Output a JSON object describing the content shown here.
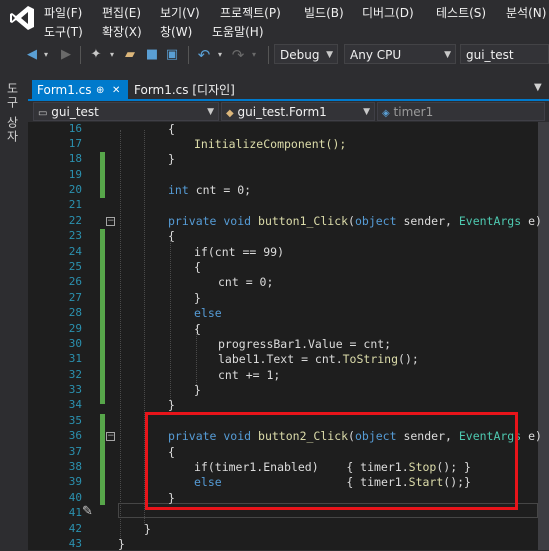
{
  "menu": {
    "row1": [
      "파일(F)",
      "편집(E)",
      "보기(V)",
      "프로젝트(P)",
      "빌드(B)",
      "디버그(D)",
      "테스트(S)",
      "분석(N)"
    ],
    "row2": [
      "도구(T)",
      "확장(X)",
      "창(W)",
      "도움말(H)"
    ]
  },
  "toolbar": {
    "config": "Debug",
    "platform": "Any CPU",
    "startup": "gui_test"
  },
  "toolbox_label": "도구 상자",
  "tabs": {
    "active": "Form1.cs",
    "active_pin": "⊕",
    "active_close": "✕",
    "inactive": "Form1.cs [디자인]"
  },
  "navbar": {
    "project": "gui_test",
    "class": "gui_test.Form1",
    "member": "timer1"
  },
  "code": {
    "line_numbers": [
      16,
      17,
      18,
      19,
      20,
      21,
      22,
      23,
      24,
      25,
      26,
      27,
      28,
      29,
      30,
      31,
      32,
      33,
      34,
      35,
      36,
      37,
      38,
      39,
      40,
      41,
      42,
      43
    ],
    "lines": {
      "l16": "{",
      "l17": "InitializeComponent();",
      "l18": "}",
      "l20_kw": "int",
      "l20": " cnt = 0;",
      "l22_a": "private void",
      "l22_m": "button1_Click",
      "l22_b": "(",
      "l22_c": "object",
      "l22_d": " sender, ",
      "l22_e": "EventArgs",
      "l22_f": " e)",
      "l23": "{",
      "l24": "if(cnt == 99)",
      "l25": "{",
      "l26": "cnt = 0;",
      "l27": "}",
      "l28": "else",
      "l29": "{",
      "l30": "progressBar1.Value = cnt;",
      "l31_a": "label1.Text = cnt.",
      "l31_m": "ToString",
      "l31_b": "();",
      "l32": "cnt += 1;",
      "l33": "}",
      "l34": "}",
      "l36_a": "private void",
      "l36_m": "button2_Click",
      "l36_b": "(",
      "l36_c": "object",
      "l36_d": " sender, ",
      "l36_e": "EventArgs",
      "l36_f": " e)",
      "l37": "{",
      "l38_a": "if(timer1.Enabled)    { timer1.",
      "l38_m": "Stop",
      "l38_b": "(); }",
      "l39_kw": "else",
      "l39_a": "                  { timer1.",
      "l39_m": "Start",
      "l39_b": "();}",
      "l40": "}",
      "l42": "}",
      "l43": "}"
    }
  },
  "colors": {
    "accent": "#007acc",
    "highlight_box": "#e8141a",
    "change_bar": "#57a64a"
  }
}
